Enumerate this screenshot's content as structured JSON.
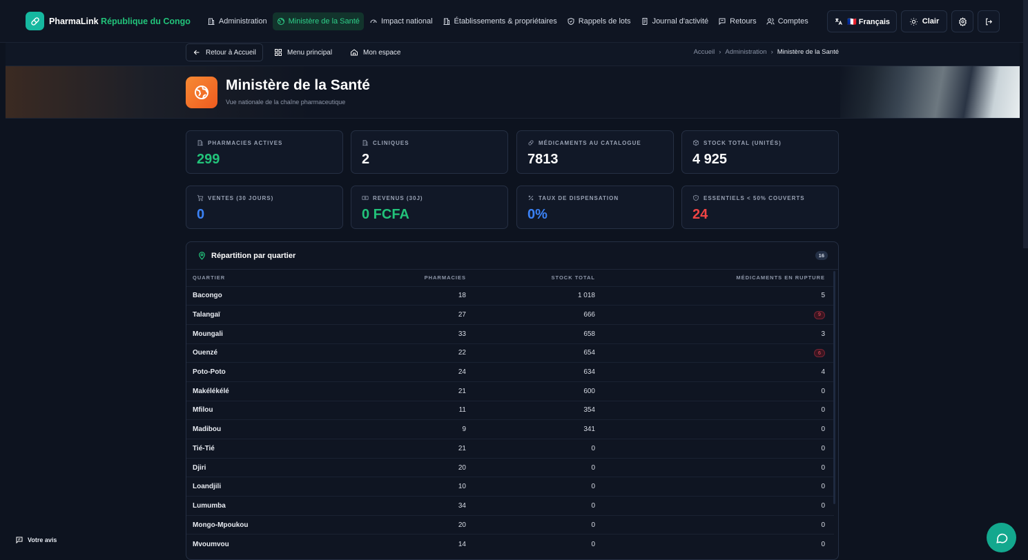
{
  "brand": {
    "name": "PharmaLink",
    "country": "République du Congo"
  },
  "nav": [
    {
      "label": "Administration",
      "icon": "building-icon",
      "name": "nav-administration",
      "active": false
    },
    {
      "label": "Ministère de la Santé",
      "icon": "globe-icon",
      "name": "nav-ministere",
      "active": true
    },
    {
      "label": "Impact national",
      "icon": "gauge-icon",
      "name": "nav-impact",
      "active": false
    },
    {
      "label": "Établissements & propriétaires",
      "icon": "building-icon",
      "name": "nav-etablissements",
      "active": false
    },
    {
      "label": "Rappels de lots",
      "icon": "shield-icon",
      "name": "nav-rappels",
      "active": false
    },
    {
      "label": "Journal d'activité",
      "icon": "scroll-icon",
      "name": "nav-journal",
      "active": false
    },
    {
      "label": "Retours",
      "icon": "message-icon",
      "name": "nav-retours",
      "active": false
    },
    {
      "label": "Comptes",
      "icon": "users-icon",
      "name": "nav-comptes",
      "active": false
    }
  ],
  "controls": {
    "language": "🇫🇷 Français",
    "theme": "Clair"
  },
  "subnav": {
    "back": "Retour à Accueil",
    "menu": "Menu principal",
    "space": "Mon espace"
  },
  "breadcrumb": [
    "Accueil",
    "Administration",
    "Ministère de la Santé"
  ],
  "hero": {
    "title": "Ministère de la Santé",
    "subtitle": "Vue nationale de la chaîne pharmaceutique"
  },
  "stats": [
    {
      "label": "PHARMACIES ACTIVES",
      "value": "299",
      "color": "#22c37a",
      "icon": "building-icon"
    },
    {
      "label": "CLINIQUES",
      "value": "2",
      "color": "#ffffff",
      "icon": "building-icon"
    },
    {
      "label": "MÉDICAMENTS AU CATALOGUE",
      "value": "7813",
      "color": "#ffffff",
      "icon": "pill-icon"
    },
    {
      "label": "STOCK TOTAL (UNITÉS)",
      "value": "4 925",
      "color": "#ffffff",
      "icon": "boxes-icon"
    },
    {
      "label": "VENTES (30 JOURS)",
      "value": "0",
      "color": "#3b82f6",
      "icon": "cart-icon"
    },
    {
      "label": "REVENUS (30J)",
      "value": "0 FCFA",
      "color": "#22c37a",
      "icon": "banknote-icon"
    },
    {
      "label": "TAUX DE DISPENSATION",
      "value": "0%",
      "color": "#3b82f6",
      "icon": "percent-icon"
    },
    {
      "label": "ESSENTIELS < 50% COUVERTS",
      "value": "24",
      "color": "#ef4444",
      "icon": "alert-shield-icon"
    }
  ],
  "district_panel": {
    "title": "Répartition par quartier",
    "count": "16",
    "columns": [
      "QUARTIER",
      "PHARMACIES",
      "STOCK TOTAL",
      "MÉDICAMENTS EN RUPTURE"
    ],
    "rows": [
      {
        "name": "Bacongo",
        "pharmacies": "18",
        "stock": "1 018",
        "rupture": "5",
        "alert": false
      },
      {
        "name": "Talangaï",
        "pharmacies": "27",
        "stock": "666",
        "rupture": "9",
        "alert": true
      },
      {
        "name": "Moungali",
        "pharmacies": "33",
        "stock": "658",
        "rupture": "3",
        "alert": false
      },
      {
        "name": "Ouenzé",
        "pharmacies": "22",
        "stock": "654",
        "rupture": "6",
        "alert": true
      },
      {
        "name": "Poto-Poto",
        "pharmacies": "24",
        "stock": "634",
        "rupture": "4",
        "alert": false
      },
      {
        "name": "Makélékélé",
        "pharmacies": "21",
        "stock": "600",
        "rupture": "0",
        "alert": false
      },
      {
        "name": "Mfilou",
        "pharmacies": "11",
        "stock": "354",
        "rupture": "0",
        "alert": false
      },
      {
        "name": "Madibou",
        "pharmacies": "9",
        "stock": "341",
        "rupture": "0",
        "alert": false
      },
      {
        "name": "Tié-Tié",
        "pharmacies": "21",
        "stock": "0",
        "rupture": "0",
        "alert": false
      },
      {
        "name": "Djiri",
        "pharmacies": "20",
        "stock": "0",
        "rupture": "0",
        "alert": false
      },
      {
        "name": "Loandjili",
        "pharmacies": "10",
        "stock": "0",
        "rupture": "0",
        "alert": false
      },
      {
        "name": "Lumumba",
        "pharmacies": "34",
        "stock": "0",
        "rupture": "0",
        "alert": false
      },
      {
        "name": "Mongo-Mpoukou",
        "pharmacies": "20",
        "stock": "0",
        "rupture": "0",
        "alert": false
      },
      {
        "name": "Mvoumvou",
        "pharmacies": "14",
        "stock": "0",
        "rupture": "0",
        "alert": false
      }
    ]
  },
  "feedback": "Votre avis"
}
